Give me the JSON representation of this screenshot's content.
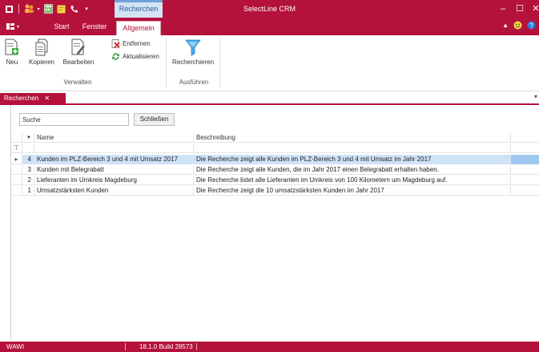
{
  "window": {
    "title": "SelectLine CRM",
    "context_tab": "Recherchen",
    "controls": {
      "minimize": "–",
      "maximize": "☐",
      "close": "✕"
    }
  },
  "ribbon_tabs": [
    {
      "label": "Start"
    },
    {
      "label": "Fenster"
    },
    {
      "label": "Allgemein"
    }
  ],
  "ribbon": {
    "groups": {
      "verwalten": "Verwalten",
      "ausfuehren": "Ausführen"
    },
    "buttons": {
      "neu": "Neu",
      "kopieren": "Kopieren",
      "bearbeiten": "Bearbeiten",
      "entfernen": "Entfernen",
      "aktualisieren": "Aktualisieren",
      "recherchieren": "Recherchieren"
    }
  },
  "doc_tab": {
    "label": "Recherchen",
    "close": "✕"
  },
  "search": {
    "value": "Suche",
    "close_label": "Schließen"
  },
  "grid": {
    "filter_glyph": "⊤",
    "columns": {
      "sort": "▼",
      "name": "Name",
      "description": "Beschreibung"
    },
    "rows": [
      {
        "marker": "▸",
        "id": "4",
        "name": "Kunden im PLZ-Bereich 3 und 4 mit Umsatz 2017",
        "description": "Die Recherche zeigt alle Kunden im PLZ-Bereich 3 und 4 mit Umsatz im Jahr 2017"
      },
      {
        "marker": "",
        "id": "3",
        "name": "Kunden mit Belegrabatt",
        "description": "Die Recherche zeigt alle Kunden, die im Jahr 2017 einen Belegrabatt erhalten haben."
      },
      {
        "marker": "",
        "id": "2",
        "name": "Lieferanten im Umkreis Magdeburg",
        "description": "Die Recherche listet alle Lieferanten im Umkreis von 100 Kilometern um Magdeburg auf."
      },
      {
        "marker": "",
        "id": "1",
        "name": "Umsatzstärksten Kunden",
        "description": "Die Recherche zeigt die 10 umsatzstärksten Kunden im Jahr 2017"
      }
    ]
  },
  "status": {
    "left": "WAWI",
    "build": "18.1.0 Build 28573"
  },
  "colors": {
    "accent": "#b4123b",
    "selection": "#cfe3f7",
    "context_tab": "#d4e3f3"
  }
}
